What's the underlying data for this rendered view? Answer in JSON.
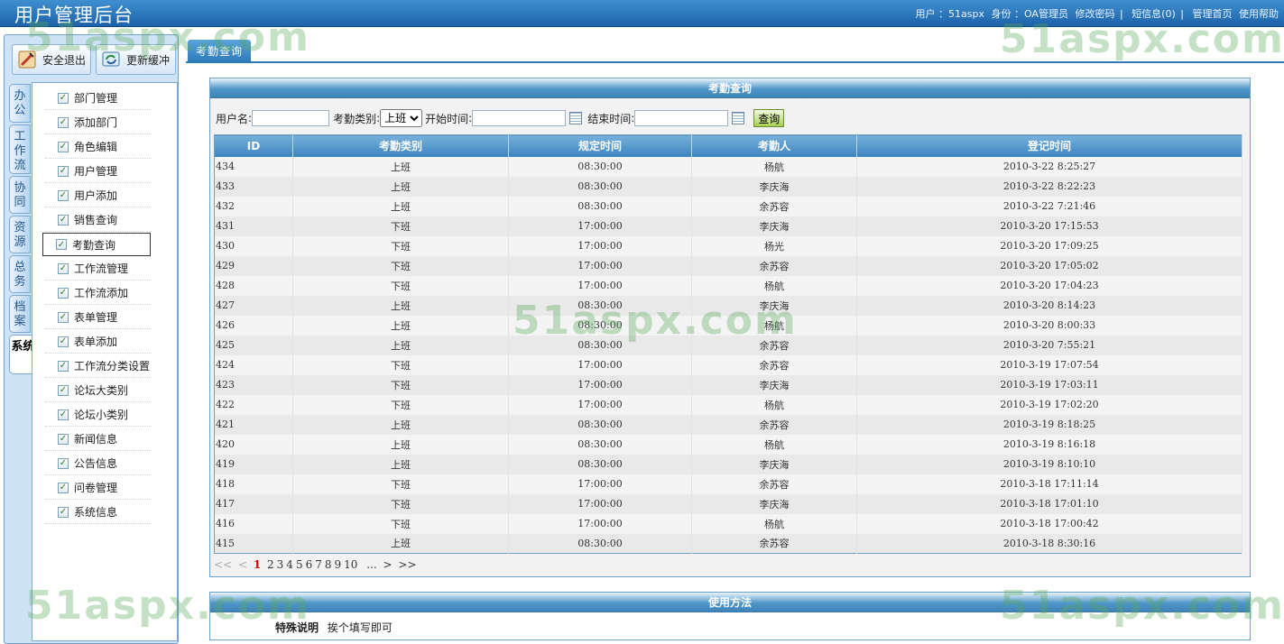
{
  "app_title": "用户管理后台",
  "top": {
    "user_label": "用户 ：51aspx",
    "role_label": "身份 ：OA管理员",
    "change_pwd": "修改密码",
    "sep": "|",
    "messages": "短信息(0)",
    "home": "管理首页",
    "help": "使用帮助"
  },
  "sidebar": {
    "logout": "安全退出",
    "refresh": "更新缓冲",
    "tabs": [
      "办公",
      "工作流",
      "协同",
      "资源",
      "总务",
      "档案",
      "系统"
    ],
    "menu": [
      "部门管理",
      "添加部门",
      "角色编辑",
      "用户管理",
      "用户添加",
      "销售查询",
      "考勤查询",
      "工作流管理",
      "工作流添加",
      "表单管理",
      "表单添加",
      "工作流分类设置",
      "论坛大类别",
      "论坛小类别",
      "新闻信息",
      "公告信息",
      "问卷管理",
      "系统信息"
    ]
  },
  "tab": {
    "label": "考勤查询"
  },
  "panel": {
    "title": "考勤查询"
  },
  "search": {
    "username_label": "用户名",
    "type_label": "考勤类别",
    "type_value": "上班",
    "start_label": "开始时间",
    "end_label": "结束时间",
    "query_button": "查询"
  },
  "table": {
    "headers": [
      "ID",
      "考勤类别",
      "规定时间",
      "考勤人",
      "登记时间"
    ],
    "rows": [
      [
        "434",
        "上班",
        "08:30:00",
        "杨航",
        "2010-3-22 8:25:27"
      ],
      [
        "433",
        "上班",
        "08:30:00",
        "李庆海",
        "2010-3-22 8:22:23"
      ],
      [
        "432",
        "上班",
        "08:30:00",
        "余苏容",
        "2010-3-22 7:21:46"
      ],
      [
        "431",
        "下班",
        "17:00:00",
        "李庆海",
        "2010-3-20 17:15:53"
      ],
      [
        "430",
        "下班",
        "17:00:00",
        "杨光",
        "2010-3-20 17:09:25"
      ],
      [
        "429",
        "下班",
        "17:00:00",
        "余苏容",
        "2010-3-20 17:05:02"
      ],
      [
        "428",
        "下班",
        "17:00:00",
        "杨航",
        "2010-3-20 17:04:23"
      ],
      [
        "427",
        "上班",
        "08:30:00",
        "李庆海",
        "2010-3-20 8:14:23"
      ],
      [
        "426",
        "上班",
        "08:30:00",
        "杨航",
        "2010-3-20 8:00:33"
      ],
      [
        "425",
        "上班",
        "08:30:00",
        "余苏容",
        "2010-3-20 7:55:21"
      ],
      [
        "424",
        "下班",
        "17:00:00",
        "余苏容",
        "2010-3-19 17:07:54"
      ],
      [
        "423",
        "下班",
        "17:00:00",
        "李庆海",
        "2010-3-19 17:03:11"
      ],
      [
        "422",
        "下班",
        "17:00:00",
        "杨航",
        "2010-3-19 17:02:20"
      ],
      [
        "421",
        "上班",
        "08:30:00",
        "余苏容",
        "2010-3-19 8:18:25"
      ],
      [
        "420",
        "上班",
        "08:30:00",
        "杨航",
        "2010-3-19 8:16:18"
      ],
      [
        "419",
        "上班",
        "08:30:00",
        "李庆海",
        "2010-3-19 8:10:10"
      ],
      [
        "418",
        "下班",
        "17:00:00",
        "余苏容",
        "2010-3-18 17:11:14"
      ],
      [
        "417",
        "下班",
        "17:00:00",
        "李庆海",
        "2010-3-18 17:01:10"
      ],
      [
        "416",
        "下班",
        "17:00:00",
        "杨航",
        "2010-3-18 17:00:42"
      ],
      [
        "415",
        "上班",
        "08:30:00",
        "余苏容",
        "2010-3-18 8:30:16"
      ]
    ]
  },
  "pager": {
    "first": "<<",
    "prev": "<",
    "current": "1",
    "pages": [
      "2",
      "3",
      "4",
      "5",
      "6",
      "7",
      "8",
      "9",
      "10"
    ],
    "ellipsis": "...",
    "next": ">",
    "last": ">>"
  },
  "help": {
    "title": "使用方法",
    "label": "特殊说明",
    "text": "挨个填写即可"
  },
  "watermark": "51aspx.com",
  "colors": {
    "header_blue": "#2b78b8",
    "current_page": "#cc0000",
    "watermark": "#5aaa5a"
  }
}
